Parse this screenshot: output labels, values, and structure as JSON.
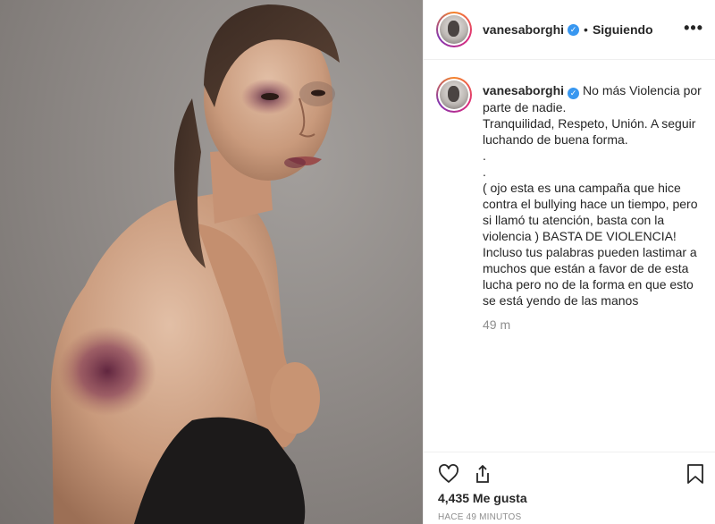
{
  "post": {
    "image_alt": "Mujer con moretones en rostro y espalda"
  },
  "header": {
    "username": "vanesaborghi",
    "dot": "•",
    "follow_status": "Siguiendo",
    "more": "•••"
  },
  "caption": {
    "username": "vanesaborghi",
    "lines": [
      "No más Violencia por",
      "parte de nadie.",
      "Tranquilidad, Respeto, Unión. A seguir",
      "luchando de buena forma.",
      ".",
      ".",
      "( ojo esta es una campaña que hice",
      "contra el bullying hace un tiempo, pero",
      "si llamó tu atención, basta con la",
      "violencia ) BASTA DE VIOLENCIA!",
      "Incluso tus palabras pueden lastimar a",
      "muchos que están a favor de de esta",
      "lucha pero no de la forma en que esto",
      "se está yendo de las manos"
    ],
    "time": "49 m"
  },
  "actions": {
    "like_icon": "heart-icon",
    "share_icon": "share-icon",
    "save_icon": "bookmark-icon",
    "likes": "4,435 Me gusta",
    "ago": "HACE 49 MINUTOS"
  },
  "colors": {
    "verified": "#3897f0",
    "muted": "#8e8e8e",
    "border": "#efefef"
  }
}
